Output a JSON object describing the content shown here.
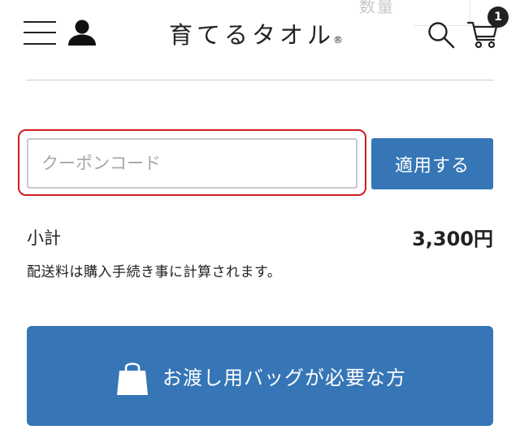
{
  "header": {
    "quantity_label": "数量",
    "logo_text": "育てるタオル",
    "logo_mark": "®",
    "cart_count": "1",
    "icons": {
      "menu": "hamburger-menu-icon",
      "account": "user-icon",
      "search": "search-icon",
      "cart": "cart-icon"
    }
  },
  "coupon": {
    "placeholder": "クーポンコード",
    "value": "",
    "apply_label": "適用する",
    "highlight_color": "#d11d22"
  },
  "summary": {
    "subtotal_label": "小計",
    "subtotal_value": "3,300円",
    "shipping_note": "配送料は購入手続き事に計算されます。"
  },
  "bag_option": {
    "label": "お渡し用バッグが必要な方",
    "icon": "shopping-bag-icon"
  },
  "colors": {
    "accent": "#3676b7",
    "text": "#222222",
    "highlight": "#d11d22"
  }
}
